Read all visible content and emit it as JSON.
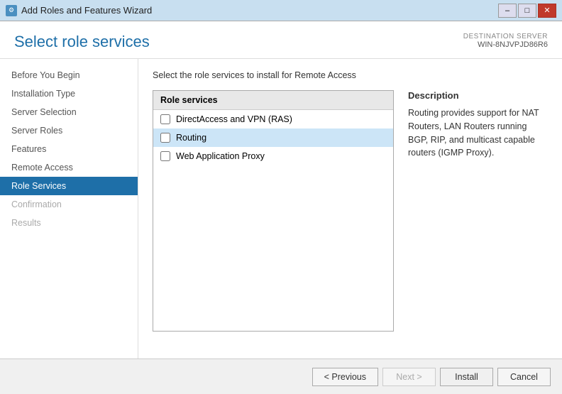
{
  "titleBar": {
    "title": "Add Roles and Features Wizard",
    "iconLabel": "W",
    "minimizeLabel": "–",
    "maximizeLabel": "□",
    "closeLabel": "✕"
  },
  "header": {
    "title": "Select role services",
    "destinationLabel": "DESTINATION SERVER",
    "serverName": "WIN-8NJVPJD86R6"
  },
  "instruction": "Select the role services to install for Remote Access",
  "sidebar": {
    "items": [
      {
        "label": "Before You Begin",
        "state": "normal"
      },
      {
        "label": "Installation Type",
        "state": "normal"
      },
      {
        "label": "Server Selection",
        "state": "normal"
      },
      {
        "label": "Server Roles",
        "state": "normal"
      },
      {
        "label": "Features",
        "state": "normal"
      },
      {
        "label": "Remote Access",
        "state": "normal"
      },
      {
        "label": "Role Services",
        "state": "active"
      },
      {
        "label": "Confirmation",
        "state": "dimmed"
      },
      {
        "label": "Results",
        "state": "dimmed"
      }
    ]
  },
  "roleServicesPanel": {
    "header": "Role services",
    "items": [
      {
        "label": "DirectAccess and VPN (RAS)",
        "checked": false,
        "selected": false
      },
      {
        "label": "Routing",
        "checked": false,
        "selected": true
      },
      {
        "label": "Web Application Proxy",
        "checked": false,
        "selected": false
      }
    ]
  },
  "description": {
    "title": "Description",
    "text": "Routing provides support for NAT Routers, LAN Routers running BGP, RIP, and multicast capable routers (IGMP Proxy)."
  },
  "footer": {
    "previousLabel": "< Previous",
    "nextLabel": "Next >",
    "installLabel": "Install",
    "cancelLabel": "Cancel"
  }
}
